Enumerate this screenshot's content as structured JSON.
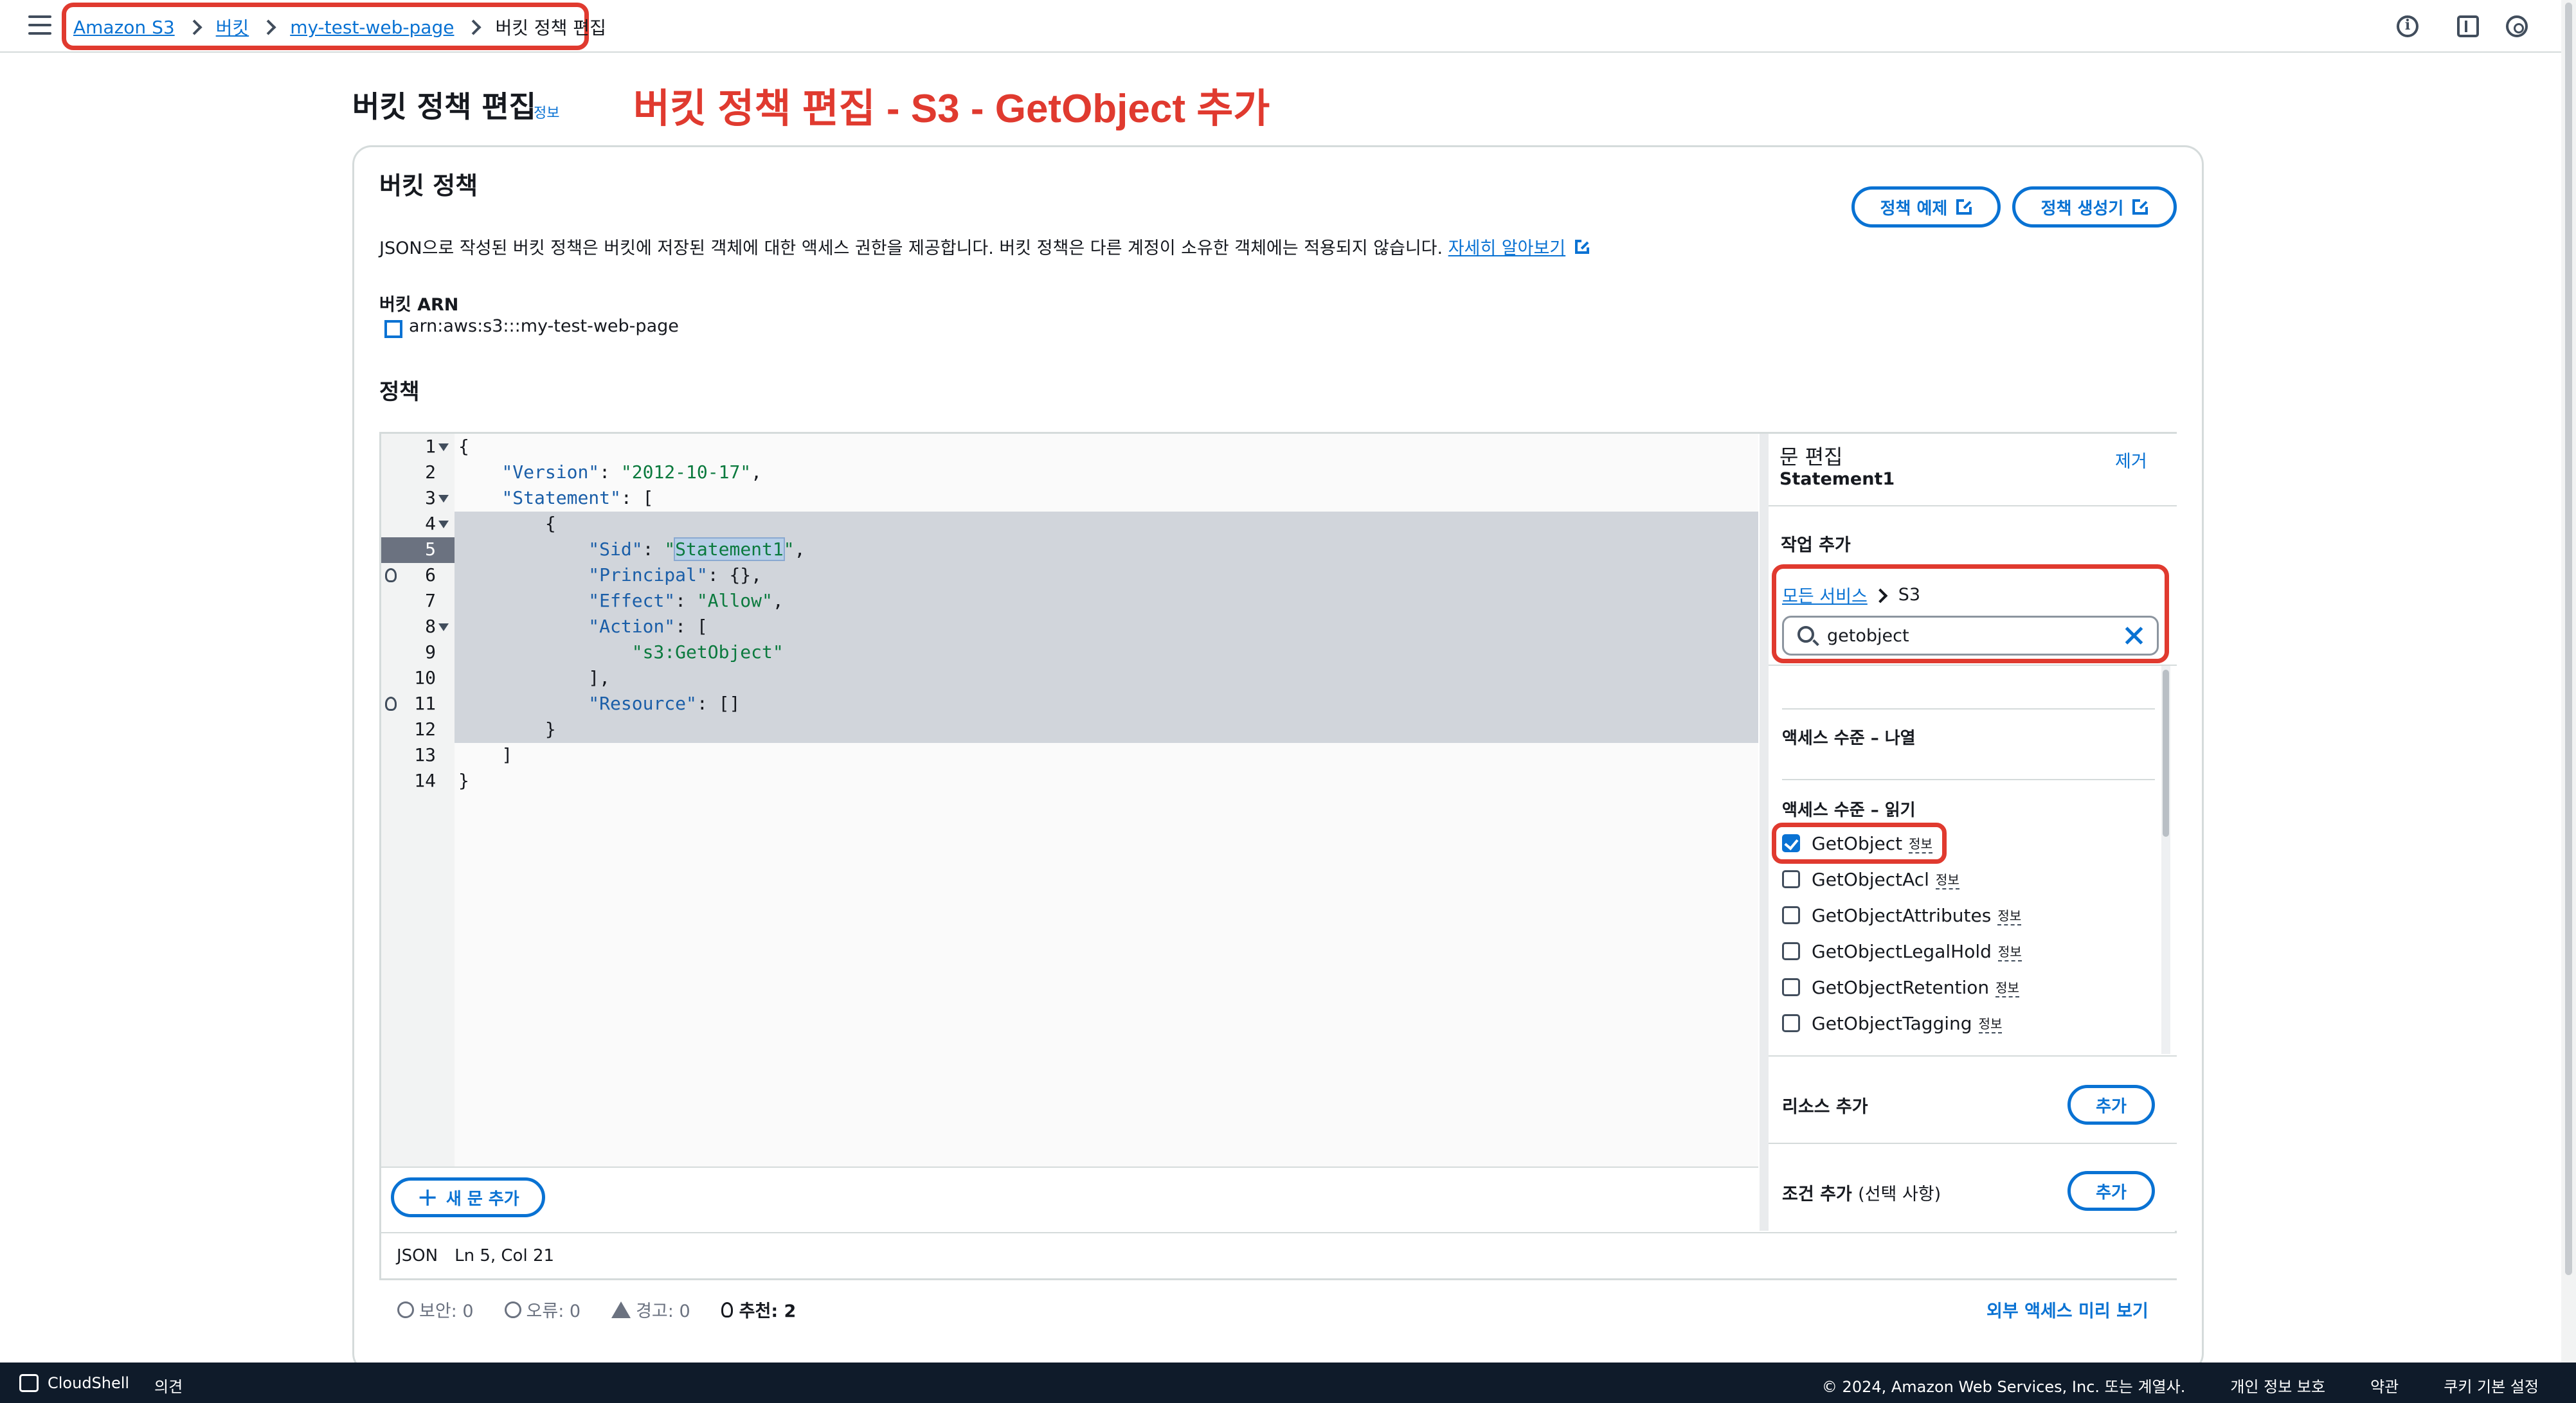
{
  "breadcrumb": {
    "items": [
      "Amazon S3",
      "버킷",
      "my-test-web-page"
    ],
    "current": "버킷 정책 편집"
  },
  "page": {
    "title": "버킷 정책 편집",
    "info": "정보",
    "annotation": "버킷 정책 편집 - S3 - GetObject 추가"
  },
  "card": {
    "title": "버킷 정책",
    "btn_examples": "정책 예제",
    "btn_generator": "정책 생성기",
    "description": "JSON으로 작성된 버킷 정책은 버킷에 저장된 객체에 대한 액세스 권한을 제공합니다. 버킷 정책은 다른 계정이 소유한 객체에는 적용되지 않습니다.",
    "learn_more": "자세히 알아보기",
    "arn_label": "버킷 ARN",
    "arn_value": "arn:aws:s3:::my-test-web-page",
    "policy_label": "정책"
  },
  "editor": {
    "lines": [
      {
        "n": "1",
        "text": "{"
      },
      {
        "n": "2",
        "text": "    \"Version\": \"2012-10-17\","
      },
      {
        "n": "3",
        "text": "    \"Statement\": ["
      },
      {
        "n": "4",
        "text": "        {"
      },
      {
        "n": "5",
        "text": "            \"Sid\": \"Statement1\","
      },
      {
        "n": "6",
        "text": "            \"Principal\": {},"
      },
      {
        "n": "7",
        "text": "            \"Effect\": \"Allow\","
      },
      {
        "n": "8",
        "text": "            \"Action\": ["
      },
      {
        "n": "9",
        "text": "                \"s3:GetObject\""
      },
      {
        "n": "10",
        "text": "            ],"
      },
      {
        "n": "11",
        "text": "            \"Resource\": []"
      },
      {
        "n": "12",
        "text": "        }"
      },
      {
        "n": "13",
        "text": "    ]"
      },
      {
        "n": "14",
        "text": "}"
      }
    ],
    "add_statement": "새 문 추가",
    "status_lang": "JSON",
    "status_pos": "Ln 5, Col 21"
  },
  "side": {
    "title": "문 편집",
    "statement": "Statement1",
    "remove": "제거",
    "action_title": "작업 추가",
    "svc_all": "모든 서비스",
    "svc_current": "S3",
    "search_value": "getobject",
    "level_list": "액세스 수준 – 나열",
    "level_read": "액세스 수준 – 읽기",
    "info_tag": "정보",
    "actions": [
      {
        "label": "GetObject",
        "checked": true
      },
      {
        "label": "GetObjectAcl",
        "checked": false
      },
      {
        "label": "GetObjectAttributes",
        "checked": false
      },
      {
        "label": "GetObjectLegalHold",
        "checked": false
      },
      {
        "label": "GetObjectRetention",
        "checked": false
      },
      {
        "label": "GetObjectTagging",
        "checked": false
      }
    ],
    "resource_label": "리소스 추가",
    "condition_label": "조건 추가",
    "condition_opt": "(선택 사항)",
    "add_btn": "추가"
  },
  "findings": {
    "security": "보안: 0",
    "errors": "오류: 0",
    "warnings": "경고: 0",
    "suggestions": "추천: 2",
    "preview_link": "외부 액세스 미리 보기"
  },
  "footer": {
    "cloudshell": "CloudShell",
    "feedback": "의견",
    "copyright": "© 2024, Amazon Web Services, Inc. 또는 계열사.",
    "privacy": "개인 정보 보호",
    "terms": "약관",
    "cookies": "쿠키 기본 설정"
  }
}
